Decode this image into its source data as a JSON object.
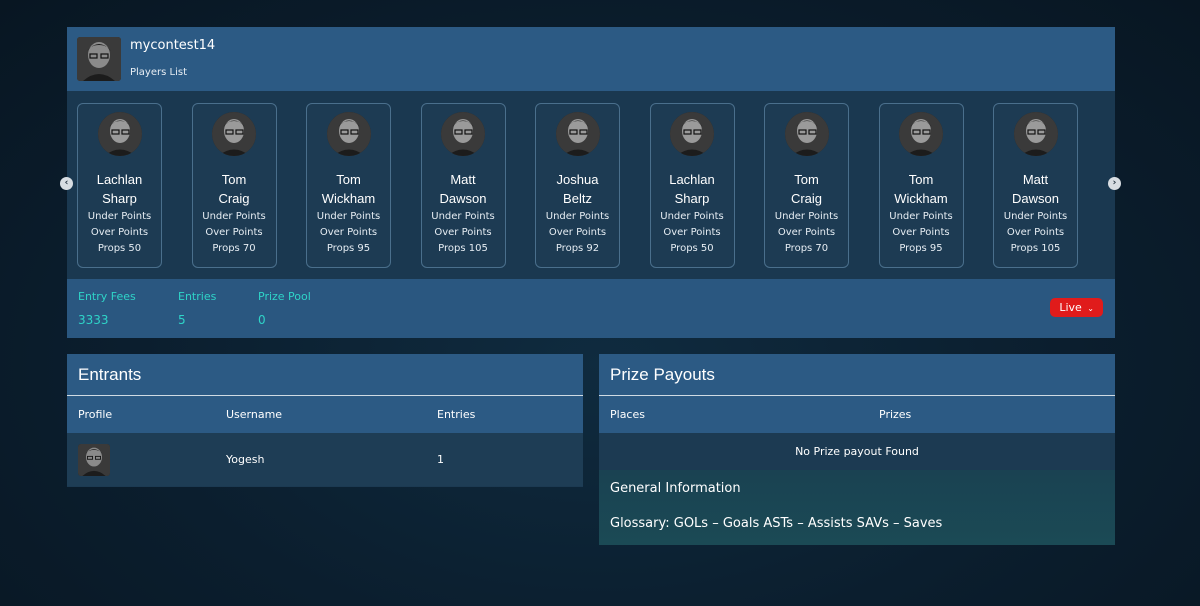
{
  "contest": {
    "name": "mycontest14",
    "subtitle": "Players List"
  },
  "players": [
    {
      "first": "Lachlan",
      "last": "Sharp",
      "under": "Under Points",
      "over": "Over Points",
      "props": "Props 50"
    },
    {
      "first": "Tom",
      "last": "Craig",
      "under": "Under Points",
      "over": "Over Points",
      "props": "Props 70"
    },
    {
      "first": "Tom",
      "last": "Wickham",
      "under": "Under Points",
      "over": "Over Points",
      "props": "Props 95"
    },
    {
      "first": "Matt",
      "last": "Dawson",
      "under": "Under Points",
      "over": "Over Points",
      "props": "Props 105"
    },
    {
      "first": "Joshua",
      "last": "Beltz",
      "under": "Under Points",
      "over": "Over Points",
      "props": "Props 92"
    },
    {
      "first": "Lachlan",
      "last": "Sharp",
      "under": "Under Points",
      "over": "Over Points",
      "props": "Props 50"
    },
    {
      "first": "Tom",
      "last": "Craig",
      "under": "Under Points",
      "over": "Over Points",
      "props": "Props 70"
    },
    {
      "first": "Tom",
      "last": "Wickham",
      "under": "Under Points",
      "over": "Over Points",
      "props": "Props 95"
    },
    {
      "first": "Matt",
      "last": "Dawson",
      "under": "Under Points",
      "over": "Over Points",
      "props": "Props 105"
    }
  ],
  "carousel": {
    "prev_icon": "chevron-left-icon",
    "next_icon": "chevron-right-icon"
  },
  "stats": {
    "entry_fees_label": "Entry Fees",
    "entry_fees_value": "3333",
    "entries_label": "Entries",
    "entries_value": "5",
    "prize_pool_label": "Prize Pool",
    "prize_pool_value": "0",
    "live_label": "Live",
    "live_icon": "chevron-down-icon"
  },
  "entrants": {
    "title": "Entrants",
    "columns": [
      "Profile",
      "Username",
      "Entries"
    ],
    "rows": [
      {
        "username": "Yogesh",
        "entries": "1"
      }
    ]
  },
  "prizes": {
    "title": "Prize Payouts",
    "columns": [
      "Places",
      "Prizes"
    ],
    "empty_message": "No Prize payout Found",
    "general_title": "General Information",
    "glossary": "Glossary: GOLs – Goals ASTs – Assists SAVs – Saves"
  },
  "colors": {
    "accent_teal": "#2fd4c8",
    "live_red": "#e01b1b",
    "panel_blue": "#2c5a84"
  }
}
